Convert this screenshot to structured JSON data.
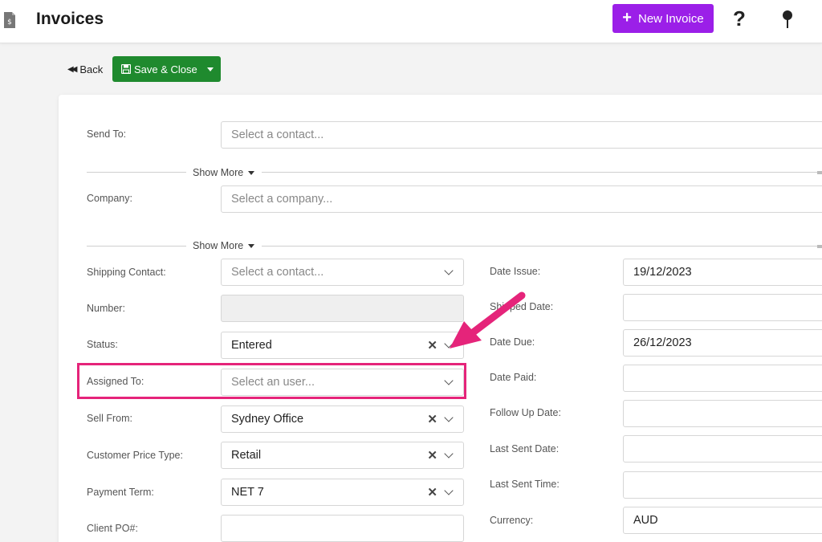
{
  "header": {
    "title": "Invoices",
    "new_invoice_label": "New Invoice",
    "help_glyph": "?"
  },
  "toolbar": {
    "back_label": "Back",
    "save_close_label": "Save & Close"
  },
  "form": {
    "send_to": {
      "label": "Send To:",
      "placeholder": "Select a contact..."
    },
    "company": {
      "label": "Company:",
      "placeholder": "Select a company..."
    },
    "show_more_label": "Show More",
    "left": {
      "shipping_contact": {
        "label": "Shipping Contact:",
        "placeholder": "Select a contact..."
      },
      "number": {
        "label": "Number:",
        "value": ""
      },
      "status": {
        "label": "Status:",
        "value": "Entered"
      },
      "assigned_to": {
        "label": "Assigned To:",
        "placeholder": "Select an user..."
      },
      "sell_from": {
        "label": "Sell From:",
        "value": "Sydney Office"
      },
      "customer_price_type": {
        "label": "Customer Price Type:",
        "value": "Retail"
      },
      "payment_term": {
        "label": "Payment Term:",
        "value": "NET 7"
      },
      "client_po": {
        "label": "Client PO#:",
        "value": ""
      }
    },
    "right": {
      "date_issue": {
        "label": "Date Issue:",
        "value": "19/12/2023"
      },
      "shipped_date": {
        "label": "Shipped Date:",
        "value": ""
      },
      "date_due": {
        "label": "Date Due:",
        "value": "26/12/2023"
      },
      "date_paid": {
        "label": "Date Paid:",
        "value": ""
      },
      "follow_up_date": {
        "label": "Follow Up Date:",
        "value": ""
      },
      "last_sent_date": {
        "label": "Last Sent Date:",
        "value": ""
      },
      "last_sent_time": {
        "label": "Last Sent Time:",
        "value": ""
      },
      "currency": {
        "label": "Currency:",
        "value": "AUD"
      }
    }
  },
  "icons": {
    "app": "invoice-document-icon",
    "help": "question-mark-icon",
    "pin": "pin-icon",
    "back": "double-chevron-left-icon",
    "save": "floppy-disk-icon",
    "clear": "close-icon",
    "dropdown": "chevron-down-icon"
  },
  "colors": {
    "primary_purple": "#9b1fe8",
    "save_green": "#1f8a2e",
    "annotation_pink": "#e5247a"
  }
}
